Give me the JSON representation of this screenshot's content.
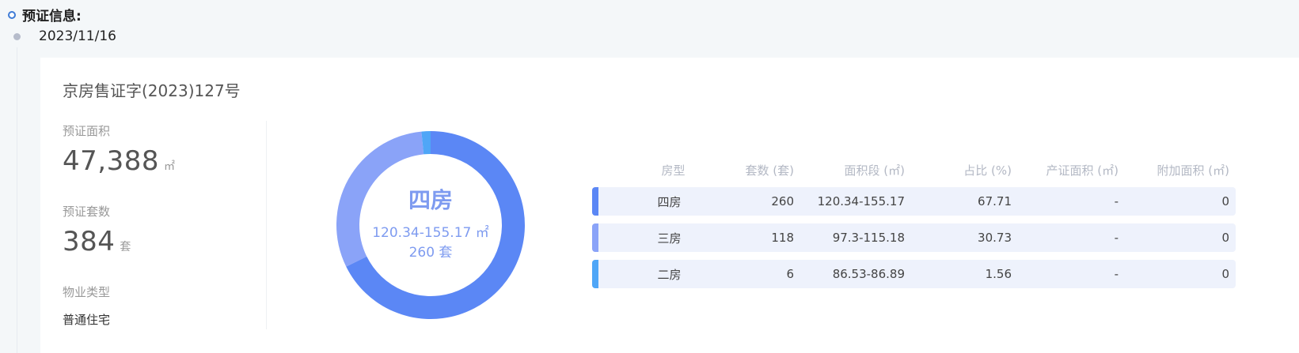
{
  "section": {
    "title": "预证信息:"
  },
  "timeline": {
    "date": "2023/11/16"
  },
  "card": {
    "permit_no": "京房售证字(2023)127号",
    "stats": {
      "area_label": "预证面积",
      "area_value": "47,388",
      "area_unit": "㎡",
      "units_label": "预证套数",
      "units_value": "384",
      "units_unit": "套",
      "type_label": "物业类型",
      "type_value": "普通住宅"
    },
    "donut_center": {
      "title": "四房",
      "range": "120.34-155.17 ㎡",
      "count": "260 套"
    },
    "table": {
      "headers": [
        "房型",
        "套数 (套)",
        "面积段 (㎡)",
        "占比 (%)",
        "产证面积 (㎡)",
        "附加面积 (㎡)"
      ],
      "rows": [
        {
          "type": "四房",
          "units": "260",
          "range": "120.34-155.17",
          "pct": "67.71",
          "cert_area": "-",
          "extra_area": "0",
          "color": "#5b87f5"
        },
        {
          "type": "三房",
          "units": "118",
          "range": "97.3-115.18",
          "pct": "30.73",
          "cert_area": "-",
          "extra_area": "0",
          "color": "#8aa3f8"
        },
        {
          "type": "二房",
          "units": "6",
          "range": "86.53-86.89",
          "pct": "1.56",
          "cert_area": "-",
          "extra_area": "0",
          "color": "#4fa6f7"
        }
      ]
    }
  },
  "colors": {
    "accent": "#3e7bd6",
    "four_room": "#5b87f5",
    "three_room": "#8aa3f8",
    "two_room": "#4fa6f7"
  }
}
